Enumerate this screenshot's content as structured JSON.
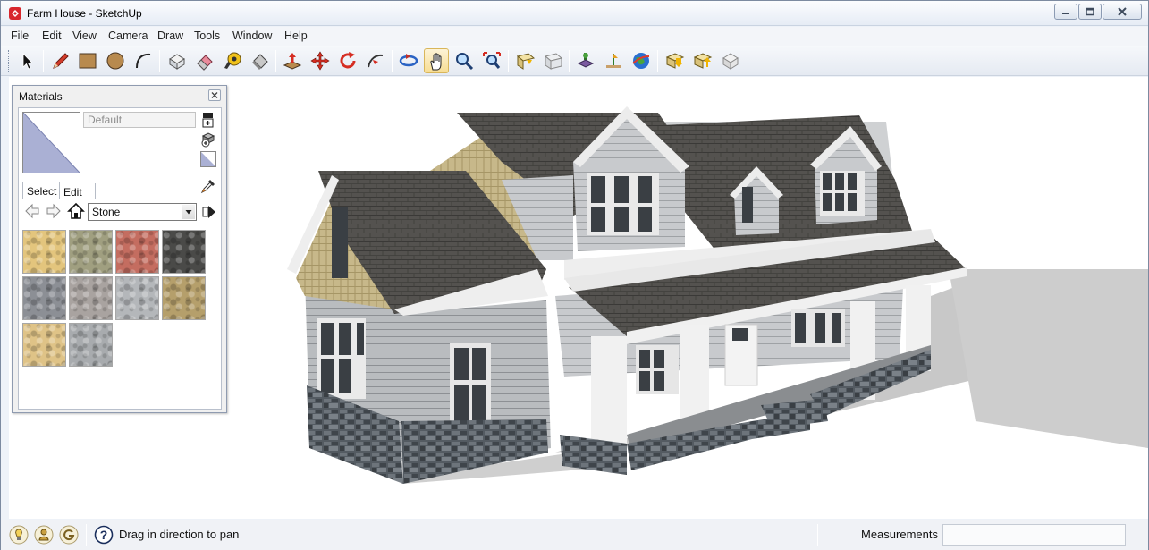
{
  "window": {
    "title": "Farm House - SketchUp"
  },
  "menu": [
    "File",
    "Edit",
    "View",
    "Camera",
    "Draw",
    "Tools",
    "Window",
    "Help"
  ],
  "toolbar": {
    "tools": [
      "select-tool",
      "pencil-tool",
      "rectangle-tool",
      "circle-tool",
      "arc-tool",
      "make-component-tool",
      "eraser-tool",
      "tape-measure-tool",
      "paint-bucket-tool",
      "push-pull-tool",
      "move-tool",
      "rotate-tool",
      "follow-me-tool",
      "orbit-tool",
      "pan-tool",
      "zoom-tool",
      "zoom-extents-tool",
      "get-models-tool",
      "share-model-tool",
      "add-location-tool",
      "toggle-terrain-tool",
      "google-earth-tool",
      "get-models-tool-2",
      "share-component-tool",
      "extension-tool"
    ],
    "active_tool": "pan-tool"
  },
  "materials": {
    "title": "Materials",
    "name_value": "Default",
    "tabs": [
      "Select",
      "Edit"
    ],
    "active_tab": "Select",
    "collection": "Stone",
    "swatch_colors": [
      "#e3c57d",
      "#a09f80",
      "#c46d60",
      "#4a4a48",
      "#8c8f95",
      "#a9a3a0",
      "#b4b7ba",
      "#b59f6b",
      "#dfc387",
      "#a8abae"
    ]
  },
  "status": {
    "hint": "Drag in direction to pan",
    "measurements_label": "Measurements",
    "measurements_value": ""
  }
}
